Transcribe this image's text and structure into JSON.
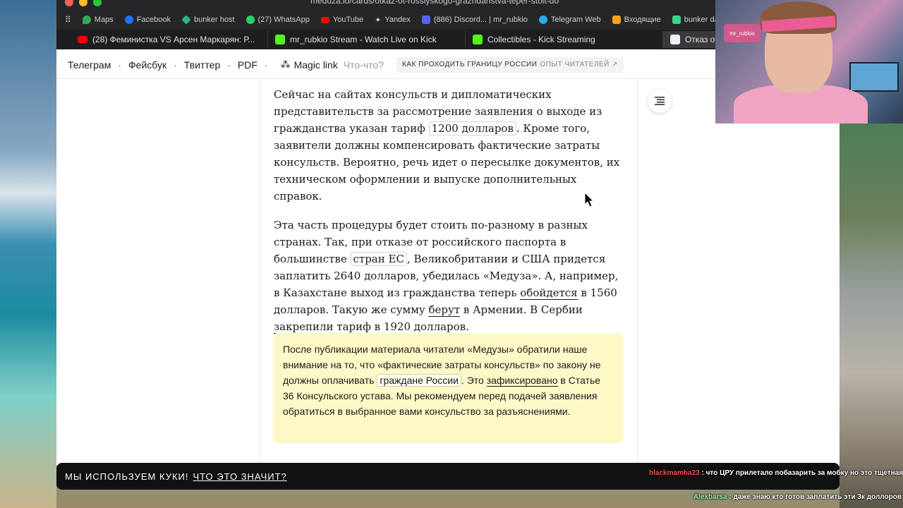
{
  "browser": {
    "url": "meduza.io/cards/otkaz-ot-rossiyskogo-grazhdanstva-teper-stoit-do",
    "bookmarks": [
      {
        "label": "Maps",
        "icon": "maps-pin-icon",
        "color": "#34a853"
      },
      {
        "label": "Facebook",
        "icon": "facebook-icon",
        "color": "#1877f2"
      },
      {
        "label": "bunker host",
        "icon": "diamond-icon",
        "color": "#2fb47c"
      },
      {
        "label": "(27) WhatsApp",
        "icon": "whatsapp-icon",
        "color": "#25d366"
      },
      {
        "label": "YouTube",
        "icon": "youtube-icon",
        "color": "#ff0000"
      },
      {
        "label": "Yandex",
        "icon": "sparkle-icon",
        "color": "#cfcfd2"
      },
      {
        "label": "(886) Discord... | mr_rubkio",
        "icon": "discord-icon",
        "color": "#5865f2"
      },
      {
        "label": "Telegram Web",
        "icon": "telegram-icon",
        "color": "#2aabee"
      },
      {
        "label": "Входящие",
        "icon": "mail-icon",
        "color": "#f6a21a"
      },
      {
        "label": "bunker database",
        "icon": "database-icon",
        "color": "#3ecf8e"
      }
    ],
    "tabs": [
      {
        "label": "(28) Феминистка VS Арсен Маркарян: Р...",
        "icon": "youtube-icon",
        "color": "#ff0000"
      },
      {
        "label": "mr_rubkio Stream - Watch Live on Kick",
        "icon": "kick-icon",
        "color": "#53fc18"
      },
      {
        "label": "Collectibles - Kick Streaming",
        "icon": "kick-icon",
        "color": "#53fc18"
      },
      {
        "label": "Отказ от ро",
        "icon": "meduza-icon",
        "color": "#333333"
      }
    ]
  },
  "site_nav": {
    "links": [
      "Телеграм",
      "Фейсбук",
      "Твиттер",
      "PDF"
    ],
    "separator": "·",
    "magic_link": "Magic link",
    "what": "Что-что?",
    "promo_title": "КАК ПРОХОДИТЬ ГРАНИЦУ РОССИИ",
    "promo_sub": "ОПЫТ ЧИТАТЕЛЕЙ ↗"
  },
  "article": {
    "p1_a": "Сейчас на сайтах консульств и дипломатических представительств за рассмотрение заявления о выходе из гражданства указан тариф ",
    "p1_link": "1200 долларов",
    "p1_b": ". Кроме того, заявители должны компенсировать фактические затраты консульств. Вероятно, речь идет о пересылке документов, их техническом оформлении и выпуске дополнительных справок.",
    "p2_a": "Эта часть процедуры будет стоить по-разному в разных странах. Так, при отказе от российского паспорта в большинстве ",
    "p2_link1": "стран ЕС",
    "p2_b": ", Великобритании и США придется заплатить 2640 долларов, убедилась «Медуза». А, например, в Казахстане выход из гражданства теперь ",
    "p2_link2": "обойдется",
    "p2_c": " в 1560 долларов. Такую же сумму ",
    "p2_link3": "берут",
    "p2_d": " в Армении. В Сербии ",
    "p2_link4": "закрепили",
    "p2_e": " тариф в 1920 долларов."
  },
  "note": {
    "a": "После публикации материала читатели «Медузы» обратили наше внимание на то, что «фактические затраты консульств» по закону не должны оплачивать ",
    "link1": "граждане России",
    "b": ". Это ",
    "link2": "зафиксировано",
    "c": " в Статье 36 Консульского устава. Мы рекомендуем перед подачей заявления обратиться в выбранное вами консульство за разъяснениями."
  },
  "cookie": {
    "text": "МЫ ИСПОЛЬЗУЕМ КУКИ!",
    "link": "ЧТО ЭТО ЗНАЧИТ?"
  },
  "chat": [
    {
      "user": "blackmamba23",
      "message": "что ЦРУ прилетало побазарить за мобку но это тщетная попытка.. ну лучше запись посмотри жека красиво разложил"
    },
    {
      "user": "Alexbarsa",
      "message": "даже знаю кто готов заплатить эти 3к доллоров"
    }
  ],
  "webcam": {
    "logo": "mr_rubkio"
  }
}
